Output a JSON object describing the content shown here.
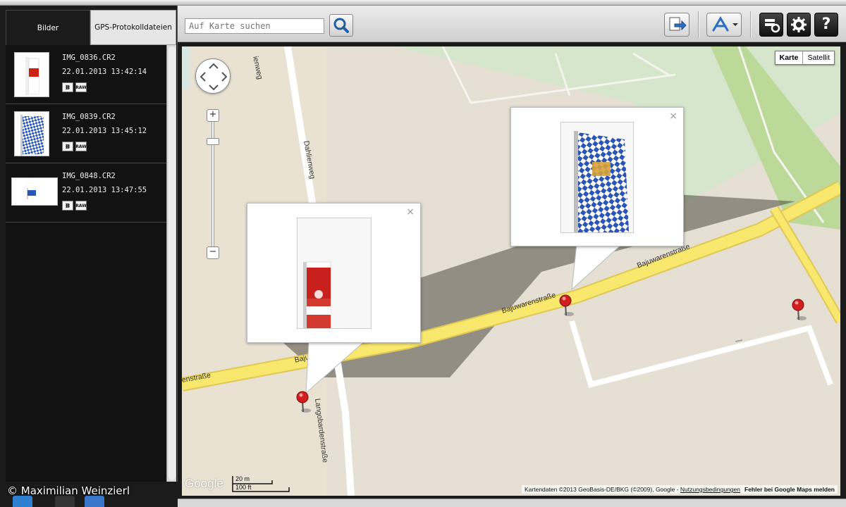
{
  "sidebar": {
    "tabs": [
      {
        "label": "Bilder"
      },
      {
        "label": "GPS-Protokolldateien"
      }
    ],
    "files": [
      {
        "name": "IMG_0836.CR2",
        "date": "22.01.2013 13:42:14",
        "raw_label": "RAW"
      },
      {
        "name": "IMG_0839.CR2",
        "date": "22.01.2013 13:45:12",
        "raw_label": "RAW"
      },
      {
        "name": "IMG_0848.CR2",
        "date": "22.01.2013 13:47:55",
        "raw_label": "RAW"
      }
    ],
    "copyright": "© Maximilian Weinzierl"
  },
  "toolbar": {
    "search_placeholder": "Auf Karte suchen",
    "icons": [
      "search-icon",
      "export-to-map-icon",
      "app-store-icon",
      "tools-icon",
      "settings-icon",
      "help-icon"
    ],
    "help_label": "?"
  },
  "map": {
    "type_buttons": {
      "map": "Karte",
      "satellite": "Satellit"
    },
    "selected_type": "Karte",
    "streets": {
      "dahlienweg_top": "ienweg",
      "dahlienweg": "Dahlienweg",
      "bajuwaren_right": "Bajuwarenstraße",
      "bajuwaren_mid": "Bajuwarenstraße",
      "bajuwaren_left": "Bajuwarenstr",
      "bajuwaren_edge": "enstraße",
      "langobarden": "Langobardenstraße"
    },
    "zoom_in": "+",
    "zoom_out": "−",
    "popup_close": "×",
    "google_logo": "Google",
    "scale": {
      "metric": "20 m",
      "imperial": "100 ft"
    },
    "attribution": {
      "text": "Kartendaten ©2013 GeoBasis-DE/BKG (©2009), Google - ",
      "terms": "Nutzungsbedingungen",
      "report": "Fehler bei Google Maps melden"
    }
  },
  "colors": {
    "panel_bg": "#1b1b1b",
    "map_bg": "#e5dfd4",
    "road_major": "#f7e76a",
    "park": "#cfe3c1",
    "pin_red": "#d11f1f"
  }
}
